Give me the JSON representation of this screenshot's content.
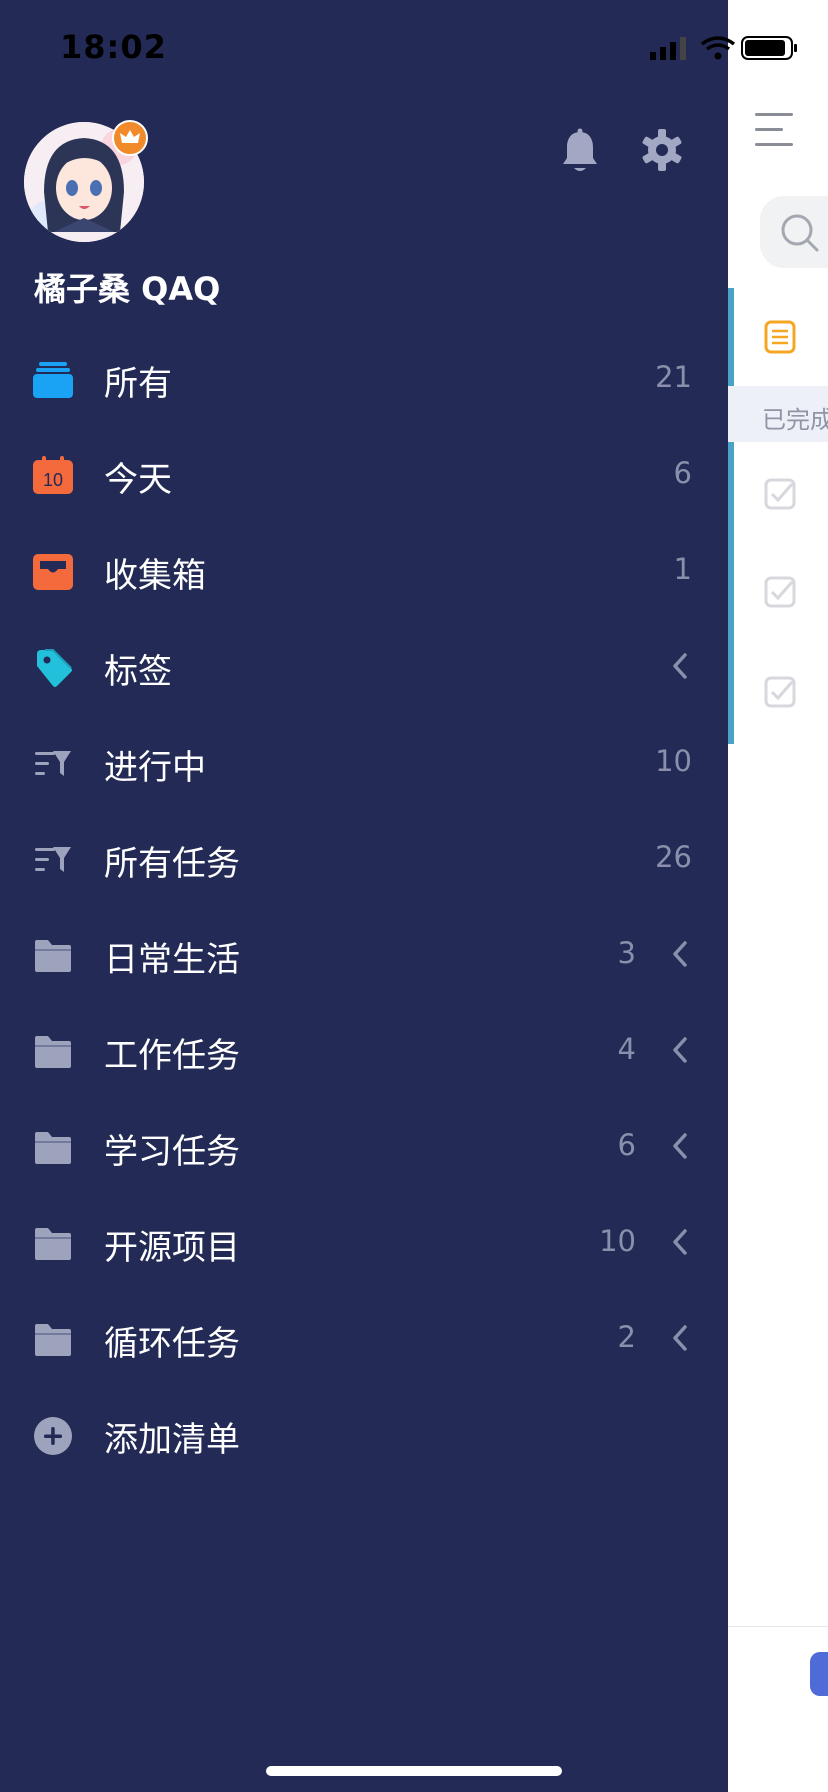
{
  "status": {
    "time": "18:02"
  },
  "user": {
    "name": "橘子桑 QAQ"
  },
  "menu": [
    {
      "label": "所有",
      "count": "21",
      "icon": "stack-icon",
      "chevron": false
    },
    {
      "label": "今天",
      "count": "6",
      "icon": "calendar-icon",
      "day": "10",
      "chevron": false
    },
    {
      "label": "收集箱",
      "count": "1",
      "icon": "inbox-icon",
      "chevron": false
    },
    {
      "label": "标签",
      "count": "",
      "icon": "tag-icon",
      "chevron": true
    },
    {
      "label": "进行中",
      "count": "10",
      "icon": "filter-icon",
      "chevron": false
    },
    {
      "label": "所有任务",
      "count": "26",
      "icon": "filter-icon",
      "chevron": false
    },
    {
      "label": "日常生活",
      "count": "3",
      "icon": "folder-icon",
      "chevron": true
    },
    {
      "label": "工作任务",
      "count": "4",
      "icon": "folder-icon",
      "chevron": true
    },
    {
      "label": "学习任务",
      "count": "6",
      "icon": "folder-icon",
      "chevron": true
    },
    {
      "label": "开源项目",
      "count": "10",
      "icon": "folder-icon",
      "chevron": true
    },
    {
      "label": "循环任务",
      "count": "2",
      "icon": "folder-icon",
      "chevron": true
    },
    {
      "label": "添加清单",
      "count": "",
      "icon": "plus-circle-icon",
      "chevron": false
    }
  ],
  "main": {
    "done_label": "已完成"
  },
  "colors": {
    "drawer_bg": "#222a55",
    "stack_blue": "#1aa3f5",
    "calendar_orange": "#f46a3c",
    "tag_cyan": "#22c0da",
    "muted_icon": "#9ea3bd",
    "accent_bar": "#4aa3c7"
  }
}
